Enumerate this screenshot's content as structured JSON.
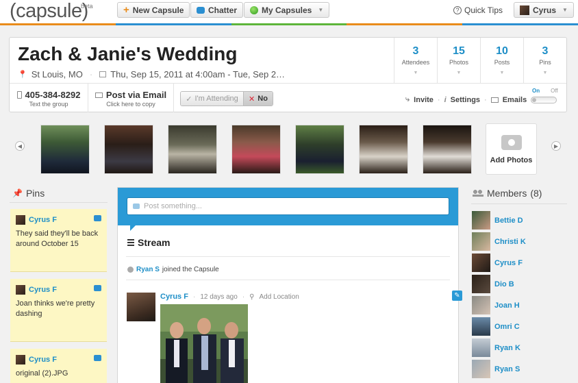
{
  "app": {
    "logo": "(capsule)",
    "beta": "beta",
    "new_capsule": "New Capsule",
    "chatter": "Chatter",
    "my_capsules": "My Capsules",
    "quick_tips": "Quick Tips",
    "quick_tips_icon": "?",
    "user": "Cyrus",
    "accent_color": "#1d8ec7"
  },
  "event": {
    "title": "Zach & Janie's Wedding",
    "location": "St Louis, MO",
    "dates": "Thu, Sep 15, 2011 at 4:00am - Tue, Sep 2…",
    "stats": [
      {
        "num": "3",
        "label": "Attendees"
      },
      {
        "num": "15",
        "label": "Photos"
      },
      {
        "num": "10",
        "label": "Posts"
      },
      {
        "num": "3",
        "label": "Pins"
      }
    ],
    "phone": "405-384-8292",
    "phone_sub": "Text the group",
    "email": "Post via Email",
    "email_sub": "Click here to copy",
    "attending": "I'm Attending",
    "attending_icon": "✓",
    "no": "No",
    "no_icon": "✕",
    "invite": "Invite",
    "settings": "Settings",
    "emails": "Emails",
    "toggle_on": "On",
    "toggle_off": "Off"
  },
  "photos": {
    "add_label": "Add Photos"
  },
  "pins": {
    "heading": "Pins",
    "items": [
      {
        "author": "Cyrus F",
        "text": "They said they'll be back around October 15"
      },
      {
        "author": "Cyrus F",
        "text": "Joan thinks we're pretty dashing"
      },
      {
        "author": "Cyrus F",
        "text": "original (2).JPG"
      }
    ]
  },
  "stream": {
    "placeholder": "Post something...",
    "title": "Stream",
    "joined_user": "Ryan S",
    "joined_text": "joined the Capsule",
    "post_author": "Cyrus F",
    "post_time": "12 days ago",
    "post_location": "Add Location"
  },
  "members": {
    "heading": "Members",
    "count": "(8)",
    "list": [
      "Bettie D",
      "Christi K",
      "Cyrus F",
      "Dio B",
      "Joan H",
      "Omri C",
      "Ryan K",
      "Ryan S"
    ]
  }
}
